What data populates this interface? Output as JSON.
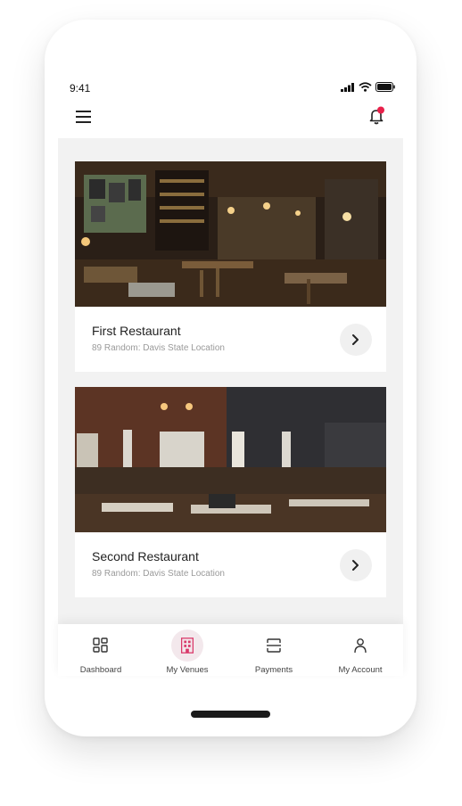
{
  "status_bar": {
    "time": "9:41"
  },
  "header": {
    "menu_icon": "hamburger-menu-icon",
    "bell_icon": "bell-icon",
    "badge_color": "#e8204a"
  },
  "venues": [
    {
      "name": "First Restaurant",
      "address": "89 Random: Davis State Location"
    },
    {
      "name": "Second Restaurant",
      "address": "89 Random: Davis State Location"
    }
  ],
  "tabbar": {
    "accent": "#d9396a",
    "items": [
      {
        "label": "Dashboard",
        "icon": "dashboard-grid-icon"
      },
      {
        "label": "My Venues",
        "icon": "building-icon",
        "active": true
      },
      {
        "label": "Payments",
        "icon": "scan-icon"
      },
      {
        "label": "My Account",
        "icon": "person-icon"
      }
    ]
  }
}
